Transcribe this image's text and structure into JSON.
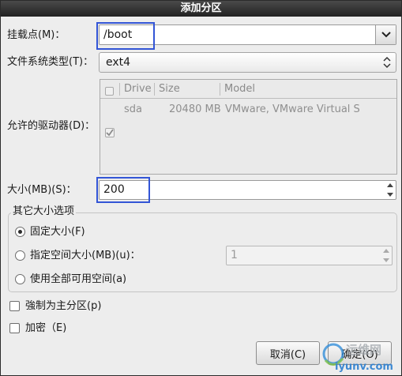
{
  "window": {
    "title": "添加分区"
  },
  "mount_point": {
    "label": "挂载点(M)：",
    "value": "/boot"
  },
  "fs_type": {
    "label": "文件系统类型(T)：",
    "value": "ext4"
  },
  "drives": {
    "label": "允许的驱动器(D)：",
    "columns": [
      "Drive",
      "Size",
      "Model"
    ],
    "rows": [
      {
        "checked": true,
        "drive": "sda",
        "size": "20480 MB",
        "model": "VMware, VMware Virtual S"
      }
    ]
  },
  "size": {
    "label": "大小(MB)(S)：",
    "value": "200"
  },
  "size_options": {
    "title": "其它大小选项",
    "fixed": "固定大小(F)",
    "fill_to": "指定空间大小(MB)(u)：",
    "fill_to_value": "1",
    "fill_all": "使用全部可用空间(a)",
    "selected": "fixed"
  },
  "primary": {
    "label": "強制为主分区(p)",
    "checked": false
  },
  "encrypt": {
    "label": "加密（E)",
    "checked": false
  },
  "buttons": {
    "cancel": "取消(C)",
    "ok": "确定(O)"
  },
  "watermark": {
    "line1": "运维网",
    "line2": "iyunv.com"
  },
  "colors": {
    "highlight": "#3355d6",
    "titlebar": "#2b2b2b"
  }
}
